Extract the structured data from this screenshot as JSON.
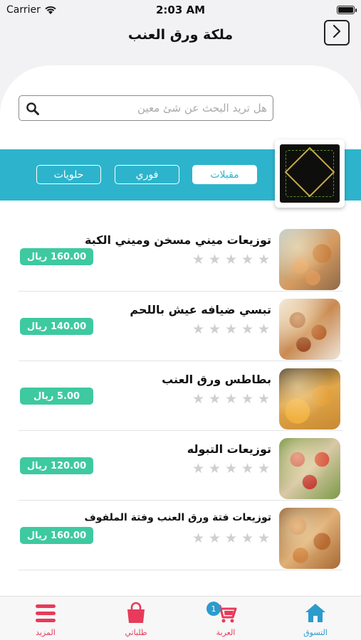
{
  "status_bar": {
    "carrier": "Carrier",
    "time": "2:03 AM"
  },
  "header": {
    "title": "ملكة ورق العنب"
  },
  "search": {
    "placeholder": "هل تريد البحث عن شئ معين"
  },
  "categories": [
    {
      "label": "مقبلات",
      "active": true
    },
    {
      "label": "فوري",
      "active": false
    },
    {
      "label": "حلويات",
      "active": false
    }
  ],
  "products": [
    {
      "name": "توزيعات ميني مسخن وميني الكبة",
      "price": "160.00 ريال",
      "rating": 0,
      "max_rating": 5
    },
    {
      "name": "تبسي ضيافه عيش باللحم",
      "price": "140.00 ريال",
      "rating": 0,
      "max_rating": 5
    },
    {
      "name": "بطاطس ورق العنب",
      "price": "5.00 ريال",
      "rating": 0,
      "max_rating": 5
    },
    {
      "name": "توزيعات التبوله",
      "price": "120.00 ريال",
      "rating": 0,
      "max_rating": 5
    },
    {
      "name": "توزيعات فتة ورق العنب وفتة الملفوف",
      "price": "160.00 ريال",
      "rating": 0,
      "max_rating": 5
    }
  ],
  "tabbar": {
    "shop": "التسوق",
    "cart": "العربة",
    "cart_count": "1",
    "orders": "طلباتي",
    "more": "المزيد"
  },
  "colors": {
    "accent_teal": "#2db4cc",
    "price_green": "#3ec9a0",
    "tab_active": "#2d9bcc",
    "tab_inactive": "#e83a5a"
  }
}
